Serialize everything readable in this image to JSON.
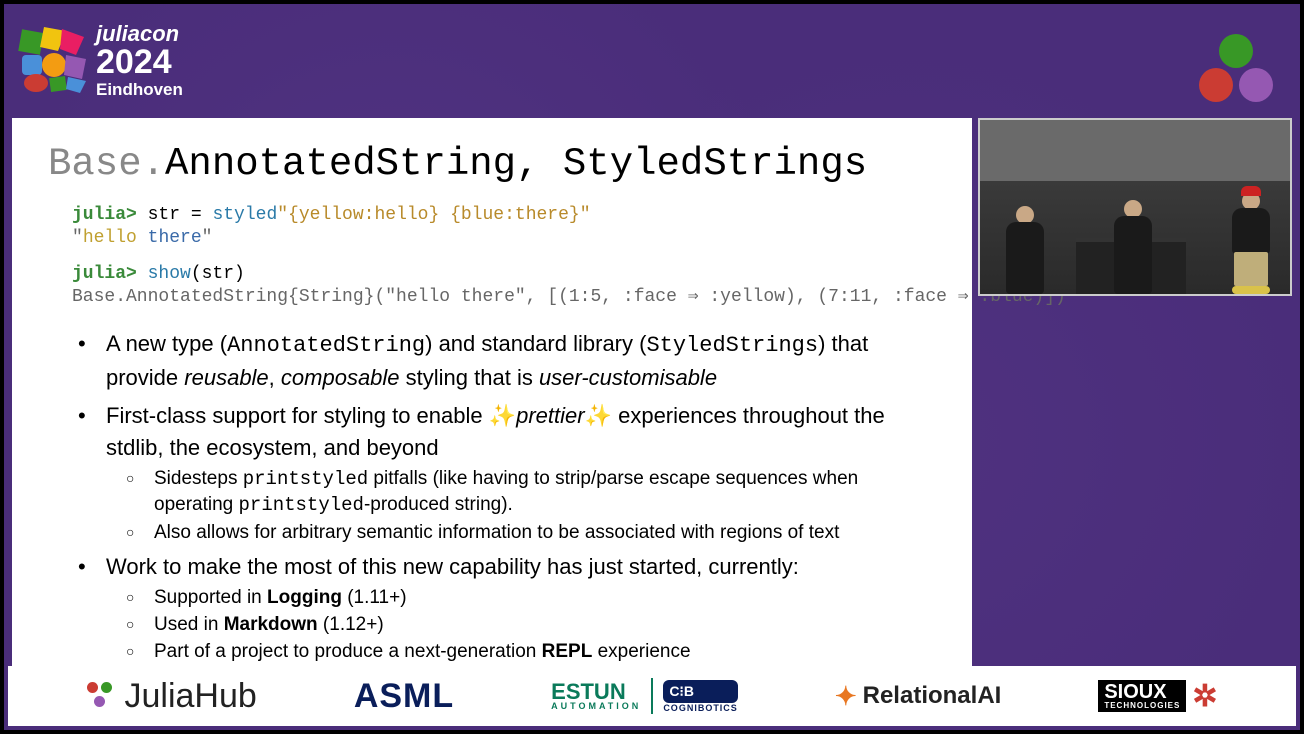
{
  "conference": {
    "name": "juliacon",
    "year": "2024",
    "city": "Eindhoven"
  },
  "slide": {
    "title_gray": "Base.",
    "title_main": "AnnotatedString, StyledStrings",
    "code1_prompt": "julia>",
    "code1_assign": " str = ",
    "code1_styled": "styled",
    "code1_literal": "\"{yellow:hello} {blue:there}\"",
    "code1_out_open": "\"",
    "code1_out_hello": "hello",
    "code1_out_sp": " ",
    "code1_out_there": "there",
    "code1_out_close": "\"",
    "code2_prompt": "julia>",
    "code2_call": " show",
    "code2_arg": "(str)",
    "code2_out": "Base.AnnotatedString{String}(\"hello there\", [(1:5, :face ⇒ :yellow), (7:11, :face ⇒ :blue)])",
    "b1_a": "A new type (",
    "b1_code1": "AnnotatedString",
    "b1_b": ") and standard library (",
    "b1_code2": "StyledStrings",
    "b1_c": ") that provide ",
    "b1_i1": "reusable",
    "b1_d": ", ",
    "b1_i2": "composable",
    "b1_e": " styling that is ",
    "b1_i3": "user-customisable",
    "b2_a": "First-class support for styling to enable ✨",
    "b2_i": "prettier",
    "b2_b": "✨ experiences throughout the stdlib, the ecosystem, and beyond",
    "b2_s1_a": "Sidesteps ",
    "b2_s1_code1": "printstyled",
    "b2_s1_b": " pitfalls (like having to strip/parse escape sequences when operating ",
    "b2_s1_code2": "printstyled",
    "b2_s1_c": "-produced string).",
    "b2_s2": "Also allows for arbitrary semantic information to be associated with regions of text",
    "b3": "Work to make the most of this new capability has just started, currently:",
    "b3_s1_a": "Supported in ",
    "b3_s1_b": "Logging",
    "b3_s1_c": " (1.11+)",
    "b3_s2_a": "Used in ",
    "b3_s2_b": "Markdown",
    "b3_s2_c": " (1.12+)",
    "b3_s3_a": "Part of a project to produce a next-generation ",
    "b3_s3_b": "REPL",
    "b3_s3_c": " experience"
  },
  "sponsors": {
    "juliahub": "JuliaHub",
    "asml": "ASML",
    "estun": "ESTUN",
    "estun_sub": "AUTOMATION",
    "cognibotics_badge": "C⁝B",
    "cognibotics": "COGNIBOTICS",
    "relational_bold": "Relational",
    "relational_rest": "AI",
    "sioux": "SIOUX",
    "sioux_sub": "TECHNOLOGIES"
  }
}
